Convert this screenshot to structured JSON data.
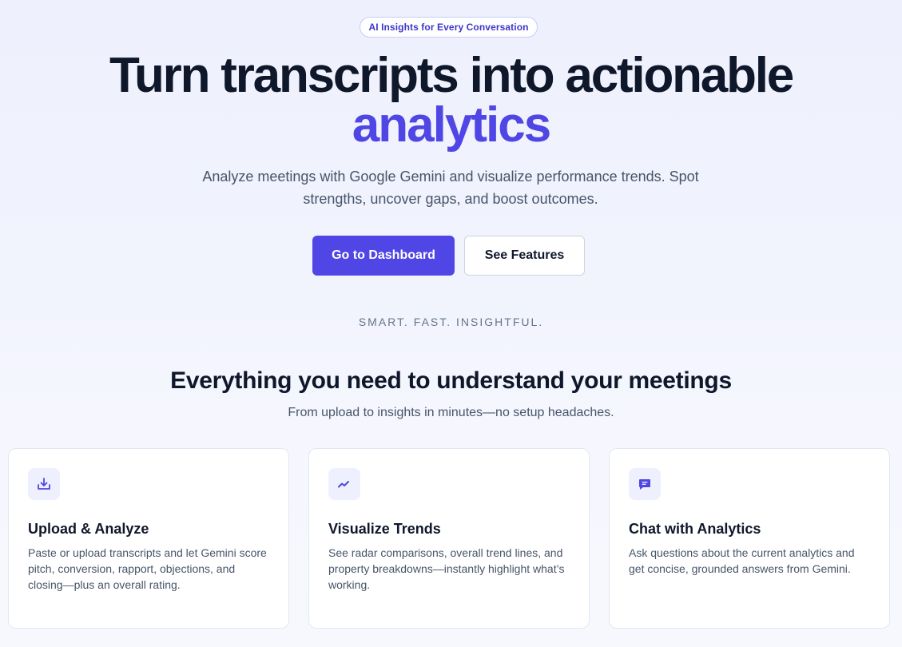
{
  "hero": {
    "badge": "AI Insights for Every Conversation",
    "title": "Turn transcripts into actionable",
    "title_accent": "analytics",
    "subtitle": "Analyze meetings with Google Gemini and visualize performance trends. Spot strengths, uncover gaps, and boost outcomes.",
    "primary_button": "Go to Dashboard",
    "secondary_button": "See Features",
    "tagline": "SMART. FAST. INSIGHTFUL."
  },
  "features": {
    "title": "Everything you need to understand your meetings",
    "subtitle": "From upload to insights in minutes—no setup headaches.",
    "cards": [
      {
        "icon": "download-icon",
        "title": "Upload & Analyze",
        "text": "Paste or upload transcripts and let Gemini score pitch, conversion, rapport, objections, and closing—plus an overall rating."
      },
      {
        "icon": "trend-icon",
        "title": "Visualize Trends",
        "text": "See radar comparisons, overall trend lines, and property breakdowns—instantly highlight what’s working."
      },
      {
        "icon": "chat-icon",
        "title": "Chat with Analytics",
        "text": "Ask questions about the current analytics and get concise, grounded answers from Gemini."
      }
    ]
  },
  "colors": {
    "accent": "#4f46e5",
    "heading": "#0f172a",
    "body_text": "#475569"
  }
}
